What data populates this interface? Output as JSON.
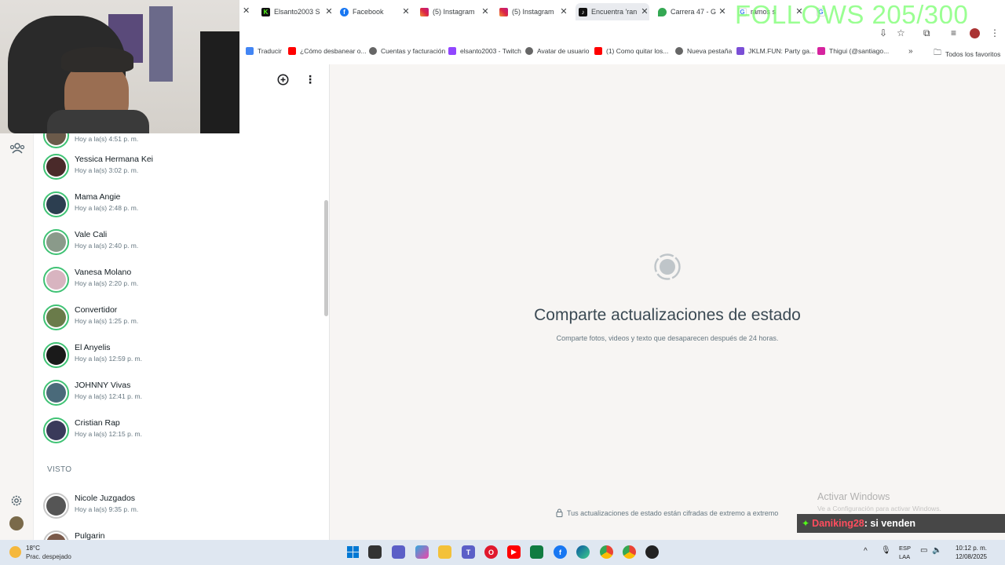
{
  "tabs": [
    {
      "label": "Elsanto2003 S",
      "icon": "kick-icon",
      "color": "#53fc18"
    },
    {
      "label": "Facebook",
      "icon": "facebook-icon",
      "color": "#1877f2"
    },
    {
      "label": "(5) Instagram",
      "icon": "instagram-icon",
      "color": "#d6249f"
    },
    {
      "label": "(5) Instagram",
      "icon": "instagram-icon",
      "color": "#d6249f"
    },
    {
      "label": "Encuentra 'ran",
      "icon": "tiktok-icon",
      "color": "#111111"
    },
    {
      "label": "Carrera 47 - G",
      "icon": "maps-icon",
      "color": "#34a853"
    },
    {
      "label": "ramos s",
      "icon": "google-icon",
      "color": "#4285f4"
    },
    {
      "label": "",
      "icon": "google-icon",
      "color": "#4285f4"
    }
  ],
  "follow_overlay": "FOLLOWS 205/300",
  "bookmarks": [
    {
      "label": "Traducir",
      "color": "#4285f4"
    },
    {
      "label": "¿Cómo desbanear o...",
      "color": "#ff0000"
    },
    {
      "label": "Cuentas y facturación",
      "color": "#555555"
    },
    {
      "label": "elsanto2003 - Twitch",
      "color": "#9146ff"
    },
    {
      "label": "Avatar de usuario",
      "color": "#555555"
    },
    {
      "label": "(1) Como quitar los...",
      "color": "#ff0000"
    },
    {
      "label": "Nueva pestaña",
      "color": "#555555"
    },
    {
      "label": "JKLM.FUN: Party ga...",
      "color": "#7b4fd6"
    },
    {
      "label": "Thigui (@santiago...",
      "color": "#d6249f"
    }
  ],
  "all_bookmarks": "Todos los favoritos",
  "statuses": [
    {
      "name": "",
      "time": "Hoy a la(s) 4:51 p. m.",
      "color": "#6b5a4a"
    },
    {
      "name": "Yessica Hermana Kei",
      "time": "Hoy a la(s) 3:02 p. m.",
      "color": "#4a2a2a"
    },
    {
      "name": "Mama Angie",
      "time": "Hoy a la(s) 2:48 p. m.",
      "color": "#2c3e50"
    },
    {
      "name": "Vale Cali",
      "time": "Hoy a la(s) 2:40 p. m.",
      "color": "#8a9a8a"
    },
    {
      "name": "Vanesa Molano",
      "time": "Hoy a la(s) 2:20 p. m.",
      "color": "#d8b4c0"
    },
    {
      "name": "Convertidor",
      "time": "Hoy a la(s) 1:25 p. m.",
      "color": "#6a7b4a"
    },
    {
      "name": "El Anyelis",
      "time": "Hoy a la(s) 12:59 p. m.",
      "color": "#1a1a1a"
    },
    {
      "name": "JOHNNY Vivas",
      "time": "Hoy a la(s) 12:41 p. m.",
      "color": "#4a6a7a"
    },
    {
      "name": "Cristian Rap",
      "time": "Hoy a la(s) 12:15 p. m.",
      "color": "#3a3a5a"
    }
  ],
  "seen_header": "VISTO",
  "seen": [
    {
      "name": "Nicole Juzgados",
      "time": "Hoy a la(s) 9:35 p. m.",
      "color": "#555555"
    },
    {
      "name": "Pulgarin",
      "time": "",
      "color": "#7a5a4a"
    }
  ],
  "main": {
    "title": "Comparte actualizaciones de estado",
    "subtitle": "Comparte fotos, videos y texto que desaparecen después de 24 horas.",
    "footer": "Tus actualizaciones de estado están cifradas de extremo a extremo"
  },
  "windows_watermark": {
    "title": "Activar Windows",
    "subtitle": "Ve a Configuración para activar Windows."
  },
  "chat_overlay": {
    "user": "Daniking28",
    "message": ": si venden"
  },
  "taskbar": {
    "weather_temp": "18°C",
    "weather_desc": "Prac. despejado",
    "lang_top": "ESP",
    "lang_bottom": "LAA",
    "time": "10:12 p. m.",
    "date": "12/08/2025"
  }
}
